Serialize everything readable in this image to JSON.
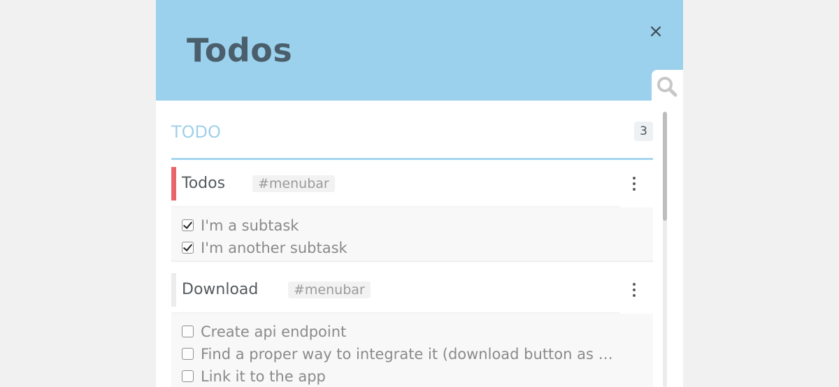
{
  "header": {
    "title": "Todos",
    "close_label": "×",
    "color": "#9bd1ec"
  },
  "icons": {
    "close": "close-icon",
    "search": "search-icon",
    "menu": "kebab-menu-icon"
  },
  "section": {
    "title": "TODO",
    "count": "3",
    "accent": "#a1d0ea"
  },
  "tasks": [
    {
      "name": "Todos",
      "tag": "#menubar",
      "priority_color": "#e86569",
      "subtasks": [
        {
          "label": "I'm a subtask",
          "checked": true
        },
        {
          "label": "I'm another subtask",
          "checked": true
        }
      ]
    },
    {
      "name": "Download",
      "tag": "#menubar",
      "priority_color": "#ececec",
      "subtasks": [
        {
          "label": "Create api endpoint",
          "checked": false
        },
        {
          "label": "Find a proper way to integrate it (download button as …",
          "checked": false
        },
        {
          "label": "Link it to the app",
          "checked": false
        }
      ]
    }
  ]
}
